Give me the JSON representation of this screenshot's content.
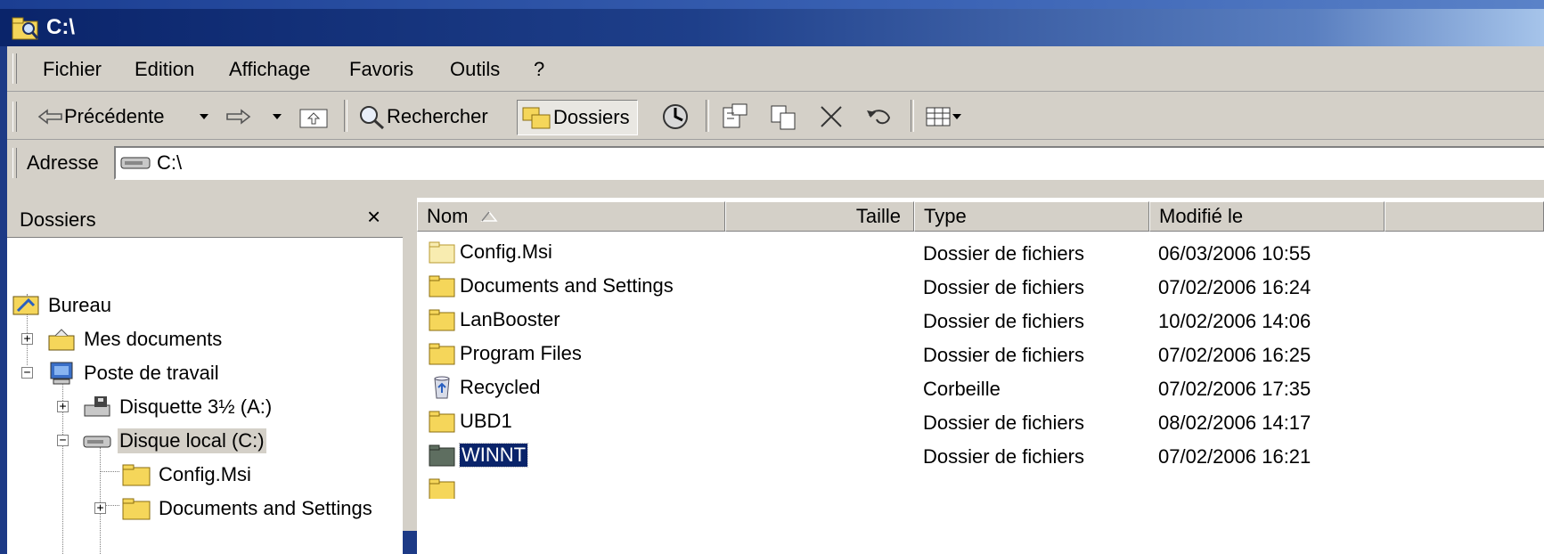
{
  "window": {
    "title": "C:\\"
  },
  "menu": [
    {
      "label": "Fichier"
    },
    {
      "label": "Edition"
    },
    {
      "label": "Affichage"
    },
    {
      "label": "Favoris"
    },
    {
      "label": "Outils"
    },
    {
      "label": "?"
    }
  ],
  "toolbar": {
    "back_label": "Précédente",
    "search_label": "Rechercher",
    "folders_label": "Dossiers"
  },
  "address": {
    "label": "Adresse",
    "value": "C:\\"
  },
  "folders_pane": {
    "title": "Dossiers",
    "close_glyph": "×",
    "tree": [
      {
        "label": "Bureau",
        "icon": "desktop-icon"
      },
      {
        "label": "Mes documents",
        "icon": "my-documents-icon"
      },
      {
        "label": "Poste de travail",
        "icon": "my-computer-icon"
      },
      {
        "label": "Disquette 3½ (A:)",
        "icon": "floppy-drive-icon"
      },
      {
        "label": "Disque local (C:)",
        "icon": "hard-drive-icon",
        "selected": true
      },
      {
        "label": "Config.Msi",
        "icon": "folder-icon"
      },
      {
        "label": "Documents and Settings",
        "icon": "folder-icon"
      }
    ]
  },
  "file_list": {
    "columns": [
      {
        "label": "Nom"
      },
      {
        "label": "Taille"
      },
      {
        "label": "Type"
      },
      {
        "label": "Modifié le"
      }
    ],
    "rows": [
      {
        "name": "Config.Msi",
        "type": "Dossier de fichiers",
        "modified": "06/03/2006 10:55",
        "icon": "folder-icon"
      },
      {
        "name": "Documents and Settings",
        "type": "Dossier de fichiers",
        "modified": "07/02/2006 16:24",
        "icon": "folder-icon"
      },
      {
        "name": "LanBooster",
        "type": "Dossier de fichiers",
        "modified": "10/02/2006 14:06",
        "icon": "folder-icon"
      },
      {
        "name": "Program Files",
        "type": "Dossier de fichiers",
        "modified": "07/02/2006 16:25",
        "icon": "folder-icon"
      },
      {
        "name": "Recycled",
        "type": "Corbeille",
        "modified": "07/02/2006 17:35",
        "icon": "recycle-bin-icon"
      },
      {
        "name": "UBD1",
        "type": "Dossier de fichiers",
        "modified": "08/02/2006 14:17",
        "icon": "folder-icon"
      },
      {
        "name": "WINNT",
        "type": "Dossier de fichiers",
        "modified": "07/02/2006 16:21",
        "icon": "folder-icon",
        "selected": true
      }
    ]
  },
  "colors": {
    "title_bar": "#0a246a",
    "face": "#d4d0c8",
    "selection": "#0a246a",
    "folder_yellow": "#f5d65a"
  }
}
